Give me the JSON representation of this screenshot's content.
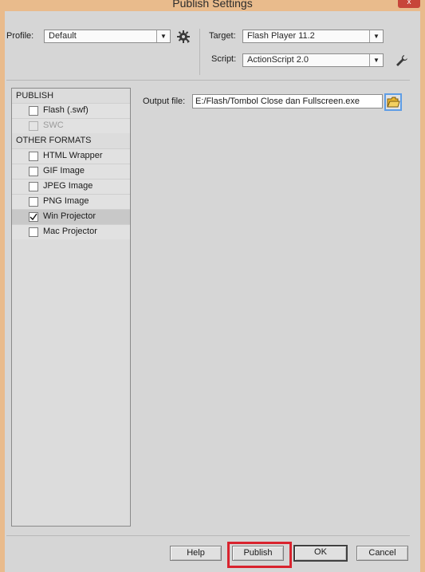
{
  "window": {
    "title": "Publish Settings",
    "close_glyph": "x"
  },
  "profile": {
    "label": "Profile:",
    "value": "Default",
    "gear_icon": "gear-icon"
  },
  "target": {
    "label": "Target:",
    "value": "Flash Player 11.2"
  },
  "script": {
    "label": "Script:",
    "value": "ActionScript 2.0",
    "wrench_icon": "wrench-icon"
  },
  "formats": {
    "publish_heading": "PUBLISH",
    "publish_items": [
      {
        "label": "Flash (.swf)",
        "checked": false,
        "disabled": false
      },
      {
        "label": "SWC",
        "checked": false,
        "disabled": true
      }
    ],
    "other_heading": "OTHER FORMATS",
    "other_items": [
      {
        "label": "HTML Wrapper",
        "checked": false,
        "disabled": false
      },
      {
        "label": "GIF Image",
        "checked": false,
        "disabled": false
      },
      {
        "label": "JPEG Image",
        "checked": false,
        "disabled": false
      },
      {
        "label": "PNG Image",
        "checked": false,
        "disabled": false
      },
      {
        "label": "Win Projector",
        "checked": true,
        "disabled": false
      },
      {
        "label": "Mac Projector",
        "checked": false,
        "disabled": false
      }
    ]
  },
  "output": {
    "label": "Output file:",
    "value": "E:/Flash/Tombol Close dan Fullscreen.exe",
    "folder_icon": "folder-icon"
  },
  "buttons": {
    "help": "Help",
    "publish": "Publish",
    "ok": "OK",
    "cancel": "Cancel"
  },
  "colors": {
    "highlight": "#d9232e",
    "focus": "#5e9de6"
  }
}
